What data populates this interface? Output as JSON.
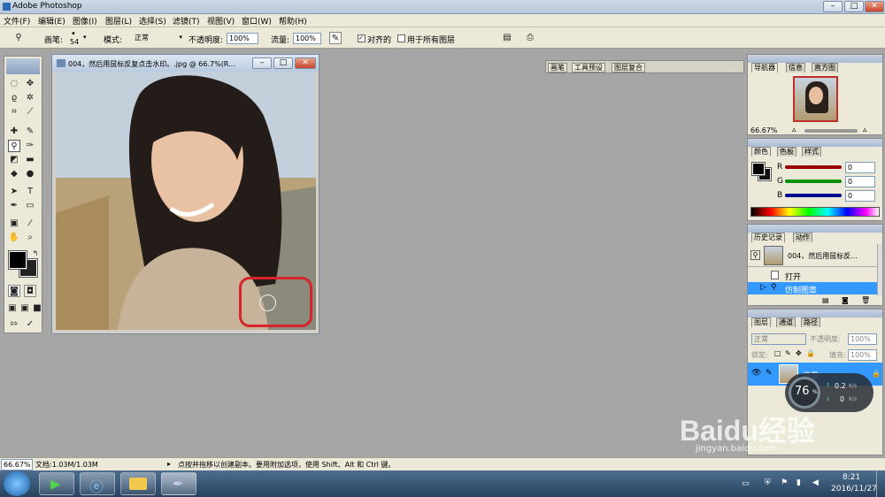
{
  "app": {
    "title": "Adobe Photoshop"
  },
  "menu": [
    "文件(F)",
    "编辑(E)",
    "图像(I)",
    "图层(L)",
    "选择(S)",
    "滤镜(T)",
    "视图(V)",
    "窗口(W)",
    "帮助(H)"
  ],
  "options": {
    "brush_label": "画笔:",
    "brush_size": "54",
    "mode_label": "模式:",
    "mode_value": "正常",
    "opacity_label": "不透明度:",
    "opacity_value": "100%",
    "flow_label": "流量:",
    "flow_value": "100%",
    "aligned_label": "对齐的",
    "all_layers_label": "用于所有图层"
  },
  "palette_well": [
    "画笔",
    "工具预设",
    "图层复合"
  ],
  "document": {
    "title": "004，然后用鼠标反复点击水印。.jpg @ 66.7%(R..."
  },
  "navigator": {
    "tabs": [
      "导航器",
      "信息",
      "直方图"
    ],
    "zoom": "66.67%"
  },
  "color_panel": {
    "tabs": [
      "颜色",
      "色板",
      "样式"
    ],
    "channels": [
      {
        "label": "R",
        "value": "0",
        "color": "#b00000"
      },
      {
        "label": "G",
        "value": "0",
        "color": "#00a000"
      },
      {
        "label": "B",
        "value": "0",
        "color": "#0000b0"
      }
    ]
  },
  "history_panel": {
    "tabs": [
      "历史记录",
      "动作"
    ],
    "snapshot": "004，然后用鼠标反...",
    "items": [
      {
        "label": "打开"
      },
      {
        "label": "仿制图章"
      }
    ]
  },
  "layers_panel": {
    "tabs": [
      "图层",
      "通道",
      "路径"
    ],
    "blend_mode": "正常",
    "opacity_label": "不透明度:",
    "opacity_value": "100%",
    "lock_label": "锁定:",
    "fill_label": "填充:",
    "fill_value": "100%",
    "layer_name": "背景"
  },
  "status": {
    "zoom": "66.67%",
    "doc": "文档:1.03M/1.03M",
    "hint": "点按并拖移以创建副本。要用附加选项，使用 Shift、Alt 和 Ctrl 键。"
  },
  "overlay": {
    "percent": "76",
    "unit": "%",
    "up": "0.2",
    "up_unit": "K/s",
    "down": "0",
    "down_unit": "K/s"
  },
  "watermark": {
    "brand": "Baidu经验",
    "url": "jingyan.baidu.com"
  },
  "taskbar": {
    "time": "8:21",
    "date": "2016/11/27"
  }
}
